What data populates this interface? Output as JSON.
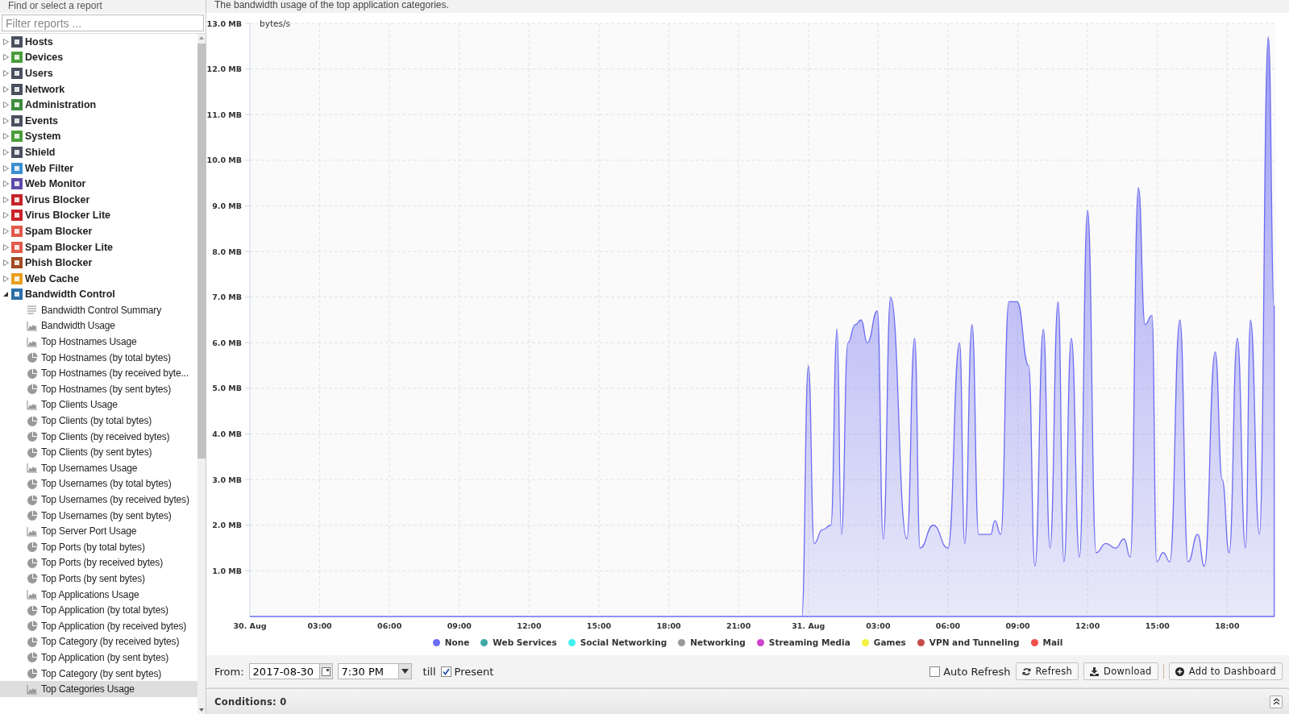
{
  "sidebar": {
    "title": "Find or select a report",
    "filter": {
      "placeholder": "Filter reports ..."
    },
    "items": [
      {
        "label": "Hosts",
        "expanded": false
      },
      {
        "label": "Devices",
        "expanded": false
      },
      {
        "label": "Users",
        "expanded": false
      },
      {
        "label": "Network",
        "expanded": false
      },
      {
        "label": "Administration",
        "expanded": false
      },
      {
        "label": "Events",
        "expanded": false
      },
      {
        "label": "System",
        "expanded": false
      },
      {
        "label": "Shield",
        "expanded": false
      },
      {
        "label": "Web Filter",
        "expanded": false
      },
      {
        "label": "Web Monitor",
        "expanded": false
      },
      {
        "label": "Virus Blocker",
        "expanded": false
      },
      {
        "label": "Virus Blocker Lite",
        "expanded": false
      },
      {
        "label": "Spam Blocker",
        "expanded": false
      },
      {
        "label": "Spam Blocker Lite",
        "expanded": false
      },
      {
        "label": "Phish Blocker",
        "expanded": false
      },
      {
        "label": "Web Cache",
        "expanded": false
      },
      {
        "label": "Bandwidth Control",
        "expanded": true,
        "children": [
          {
            "label": "Bandwidth Control Summary",
            "kind": "summary",
            "selected": false
          },
          {
            "label": "Bandwidth Usage",
            "kind": "area",
            "selected": false
          },
          {
            "label": "Top Hostnames Usage",
            "kind": "area",
            "selected": false
          },
          {
            "label": "Top Hostnames (by total bytes)",
            "kind": "pie",
            "selected": false
          },
          {
            "label": "Top Hostnames (by received byte...",
            "kind": "pie",
            "selected": false
          },
          {
            "label": "Top Hostnames (by sent bytes)",
            "kind": "pie",
            "selected": false
          },
          {
            "label": "Top Clients Usage",
            "kind": "area",
            "selected": false
          },
          {
            "label": "Top Clients (by total bytes)",
            "kind": "pie",
            "selected": false
          },
          {
            "label": "Top Clients (by received bytes)",
            "kind": "pie",
            "selected": false
          },
          {
            "label": "Top Clients (by sent bytes)",
            "kind": "pie",
            "selected": false
          },
          {
            "label": "Top Usernames Usage",
            "kind": "area",
            "selected": false
          },
          {
            "label": "Top Usernames (by total bytes)",
            "kind": "pie",
            "selected": false
          },
          {
            "label": "Top Usernames (by received bytes)",
            "kind": "pie",
            "selected": false
          },
          {
            "label": "Top Usernames (by sent bytes)",
            "kind": "pie",
            "selected": false
          },
          {
            "label": "Top Server Port Usage",
            "kind": "area",
            "selected": false
          },
          {
            "label": "Top Ports (by total bytes)",
            "kind": "pie",
            "selected": false
          },
          {
            "label": "Top Ports (by received bytes)",
            "kind": "pie",
            "selected": false
          },
          {
            "label": "Top Ports (by sent bytes)",
            "kind": "pie",
            "selected": false
          },
          {
            "label": "Top Applications Usage",
            "kind": "area",
            "selected": false
          },
          {
            "label": "Top Application (by total bytes)",
            "kind": "pie",
            "selected": false
          },
          {
            "label": "Top Application (by received bytes)",
            "kind": "pie",
            "selected": false
          },
          {
            "label": "Top Category (by received bytes)",
            "kind": "pie",
            "selected": false
          },
          {
            "label": "Top Application (by sent bytes)",
            "kind": "pie",
            "selected": false
          },
          {
            "label": "Top Category (by sent bytes)",
            "kind": "pie",
            "selected": false
          },
          {
            "label": "Top Categories Usage",
            "kind": "area",
            "selected": true
          }
        ]
      }
    ]
  },
  "report": {
    "description": "The bandwidth usage of the top application categories.",
    "chart_data": {
      "type": "area",
      "grid": true,
      "ylabel": "bytes/s",
      "xlim": [
        "2017-08-30 00:00",
        "2017-08-31 20:06"
      ],
      "ylim": [
        0,
        13
      ],
      "xticks": [
        {
          "value": "2017-08-30 00:00",
          "label": "30. Aug"
        },
        {
          "value": "2017-08-30 03:00",
          "label": "03:00"
        },
        {
          "value": "2017-08-30 06:00",
          "label": "06:00"
        },
        {
          "value": "2017-08-30 09:00",
          "label": "09:00"
        },
        {
          "value": "2017-08-30 12:00",
          "label": "12:00"
        },
        {
          "value": "2017-08-30 15:00",
          "label": "15:00"
        },
        {
          "value": "2017-08-30 18:00",
          "label": "18:00"
        },
        {
          "value": "2017-08-30 21:00",
          "label": "21:00"
        },
        {
          "value": "2017-08-31 00:00",
          "label": "31. Aug"
        },
        {
          "value": "2017-08-31 03:00",
          "label": "03:00"
        },
        {
          "value": "2017-08-31 06:00",
          "label": "06:00"
        },
        {
          "value": "2017-08-31 09:00",
          "label": "09:00"
        },
        {
          "value": "2017-08-31 12:00",
          "label": "12:00"
        },
        {
          "value": "2017-08-31 15:00",
          "label": "15:00"
        },
        {
          "value": "2017-08-31 18:00",
          "label": "18:00"
        }
      ],
      "yticks": [
        {
          "value": 1,
          "label": "1.0 MB"
        },
        {
          "value": 2,
          "label": "2.0 MB"
        },
        {
          "value": 3,
          "label": "3.0 MB"
        },
        {
          "value": 4,
          "label": "4.0 MB"
        },
        {
          "value": 5,
          "label": "5.0 MB"
        },
        {
          "value": 6,
          "label": "6.0 MB"
        },
        {
          "value": 7,
          "label": "7.0 MB"
        },
        {
          "value": 8,
          "label": "8.0 MB"
        },
        {
          "value": 9,
          "label": "9.0 MB"
        },
        {
          "value": 10,
          "label": "10.0 MB"
        },
        {
          "value": 11,
          "label": "11.0 MB"
        },
        {
          "value": 12,
          "label": "12.0 MB"
        },
        {
          "value": 13,
          "label": "13.0 MB"
        }
      ],
      "x": [
        "2017-08-30 00:00",
        "2017-08-30 23:43",
        "2017-08-31 00:00",
        "2017-08-31 00:15",
        "2017-08-31 00:36",
        "2017-08-31 00:58",
        "2017-08-31 01:14",
        "2017-08-31 01:25",
        "2017-08-31 01:42",
        "2017-08-31 02:01",
        "2017-08-31 02:16",
        "2017-08-31 02:32",
        "2017-08-31 02:58",
        "2017-08-31 03:13",
        "2017-08-31 03:32",
        "2017-08-31 04:14",
        "2017-08-31 04:34",
        "2017-08-31 04:48",
        "2017-08-31 05:22",
        "2017-08-31 06:00",
        "2017-08-31 06:30",
        "2017-08-31 06:43",
        "2017-08-31 07:02",
        "2017-08-31 07:19",
        "2017-08-31 07:50",
        "2017-08-31 08:01",
        "2017-08-31 08:16",
        "2017-08-31 08:37",
        "2017-08-31 08:58",
        "2017-08-31 09:28",
        "2017-08-31 09:44",
        "2017-08-31 10:06",
        "2017-08-31 10:23",
        "2017-08-31 10:44",
        "2017-08-31 10:59",
        "2017-08-31 11:18",
        "2017-08-31 11:39",
        "2017-08-31 12:00",
        "2017-08-31 12:22",
        "2017-08-31 12:47",
        "2017-08-31 13:12",
        "2017-08-31 13:34",
        "2017-08-31 13:50",
        "2017-08-31 14:11",
        "2017-08-31 14:28",
        "2017-08-31 14:46",
        "2017-08-31 14:58",
        "2017-08-31 15:15",
        "2017-08-31 15:32",
        "2017-08-31 15:58",
        "2017-08-31 16:19",
        "2017-08-31 16:44",
        "2017-08-31 17:01",
        "2017-08-31 17:29",
        "2017-08-31 17:47",
        "2017-08-31 18:05",
        "2017-08-31 18:26",
        "2017-08-31 18:47",
        "2017-08-31 19:00",
        "2017-08-31 19:23",
        "2017-08-31 19:46",
        "2017-08-31 20:01"
      ],
      "series": [
        {
          "name": "None",
          "color": "#6c6cf2",
          "values": [
            0,
            0,
            5.5,
            1.6,
            1.9,
            2.0,
            6.3,
            1.8,
            6.0,
            6.4,
            6.5,
            6.0,
            6.7,
            1.7,
            7.0,
            1.7,
            6.1,
            1.5,
            2.0,
            1.5,
            6.0,
            1.6,
            6.4,
            1.8,
            1.8,
            2.1,
            1.8,
            6.9,
            6.9,
            5.5,
            1.1,
            6.3,
            1.5,
            6.9,
            1.2,
            6.1,
            1.3,
            8.9,
            1.4,
            1.6,
            1.5,
            1.7,
            1.3,
            9.4,
            6.4,
            6.6,
            1.2,
            1.4,
            1.2,
            6.5,
            1.2,
            1.8,
            1.1,
            5.8,
            3.0,
            1.4,
            6.1,
            1.5,
            6.5,
            1.8,
            12.7,
            6.8
          ]
        },
        {
          "name": "Web Services",
          "color": "#3fa9a5",
          "values": [
            null,
            null,
            null,
            null,
            null,
            null,
            null,
            null,
            null,
            null,
            null,
            null,
            null,
            null,
            null,
            null,
            null,
            null,
            null,
            null,
            null,
            null,
            null,
            null,
            null,
            null,
            null,
            null,
            null,
            null,
            null,
            null,
            null,
            null,
            null,
            null,
            null,
            null,
            null,
            null,
            null,
            null,
            null,
            null,
            null,
            null,
            null,
            null,
            null,
            null,
            null,
            null,
            null,
            null,
            null,
            null,
            null,
            null,
            null,
            null,
            null,
            null
          ]
        },
        {
          "name": "Social Networking",
          "color": "#44f0f2",
          "values": [
            null,
            null,
            null,
            null,
            null,
            null,
            null,
            null,
            null,
            null,
            null,
            null,
            null,
            null,
            null,
            null,
            null,
            null,
            null,
            null,
            null,
            null,
            null,
            null,
            null,
            null,
            null,
            null,
            null,
            null,
            null,
            null,
            null,
            null,
            null,
            null,
            null,
            null,
            null,
            null,
            null,
            null,
            null,
            null,
            null,
            null,
            null,
            null,
            null,
            null,
            null,
            null,
            null,
            null,
            null,
            null,
            null,
            null,
            null,
            null,
            null,
            null
          ]
        },
        {
          "name": "Networking",
          "color": "#999999",
          "values": [
            null,
            null,
            null,
            null,
            null,
            null,
            null,
            null,
            null,
            null,
            null,
            null,
            null,
            null,
            null,
            null,
            null,
            null,
            null,
            null,
            null,
            null,
            null,
            null,
            null,
            null,
            null,
            null,
            null,
            null,
            null,
            null,
            null,
            null,
            null,
            null,
            null,
            null,
            null,
            null,
            null,
            null,
            null,
            null,
            null,
            null,
            null,
            null,
            null,
            null,
            null,
            null,
            null,
            null,
            null,
            null,
            null,
            null,
            null,
            null,
            null,
            null
          ]
        },
        {
          "name": "Streaming Media",
          "color": "#cc44cc",
          "values": [
            null,
            null,
            null,
            null,
            null,
            null,
            null,
            null,
            null,
            null,
            null,
            null,
            null,
            null,
            null,
            null,
            null,
            null,
            null,
            null,
            null,
            null,
            null,
            null,
            null,
            null,
            null,
            null,
            null,
            null,
            null,
            null,
            null,
            null,
            null,
            null,
            null,
            null,
            null,
            null,
            null,
            null,
            null,
            null,
            null,
            null,
            null,
            null,
            null,
            null,
            null,
            null,
            null,
            null,
            null,
            null,
            null,
            null,
            null,
            null,
            null,
            null
          ]
        },
        {
          "name": "Games",
          "color": "#f2f23f",
          "values": [
            null,
            null,
            null,
            null,
            null,
            null,
            null,
            null,
            null,
            null,
            null,
            null,
            null,
            null,
            null,
            null,
            null,
            null,
            null,
            null,
            null,
            null,
            null,
            null,
            null,
            null,
            null,
            null,
            null,
            null,
            null,
            null,
            null,
            null,
            null,
            null,
            null,
            null,
            null,
            null,
            null,
            null,
            null,
            null,
            null,
            null,
            null,
            null,
            null,
            null,
            null,
            null,
            null,
            null,
            null,
            null,
            null,
            null,
            null,
            null,
            null,
            null
          ]
        },
        {
          "name": "VPN and Tunneling",
          "color": "#c44d4d",
          "values": [
            null,
            null,
            null,
            null,
            null,
            null,
            null,
            null,
            null,
            null,
            null,
            null,
            null,
            null,
            null,
            null,
            null,
            null,
            null,
            null,
            null,
            null,
            null,
            null,
            null,
            null,
            null,
            null,
            null,
            null,
            null,
            null,
            null,
            null,
            null,
            null,
            null,
            null,
            null,
            null,
            null,
            null,
            null,
            null,
            null,
            null,
            null,
            null,
            null,
            null,
            null,
            null,
            null,
            null,
            null,
            null,
            null,
            null,
            null,
            null,
            null,
            null
          ]
        },
        {
          "name": "Mail",
          "color": "#f24d4d",
          "values": [
            null,
            null,
            null,
            null,
            null,
            null,
            null,
            null,
            null,
            null,
            null,
            null,
            null,
            null,
            null,
            null,
            null,
            null,
            null,
            null,
            null,
            null,
            null,
            null,
            null,
            null,
            null,
            null,
            null,
            null,
            null,
            null,
            null,
            null,
            null,
            null,
            null,
            null,
            null,
            null,
            null,
            null,
            null,
            null,
            null,
            null,
            null,
            null,
            null,
            null,
            null,
            null,
            null,
            null,
            null,
            null,
            null,
            null,
            null,
            null,
            null,
            null
          ]
        }
      ]
    }
  },
  "toolbar": {
    "from_label": "From:",
    "date": "2017-08-30",
    "time": "7:30 PM",
    "till_label": "till",
    "present": {
      "label": "Present",
      "checked": true
    },
    "auto_refresh": {
      "label": "Auto Refresh",
      "checked": false
    },
    "buttons": [
      {
        "label": "Refresh",
        "kind": "refresh"
      },
      {
        "label": "Download",
        "kind": "download"
      },
      {
        "label": "Add to Dashboard",
        "kind": "add"
      }
    ]
  },
  "conditions": {
    "label": "Conditions: 0"
  }
}
